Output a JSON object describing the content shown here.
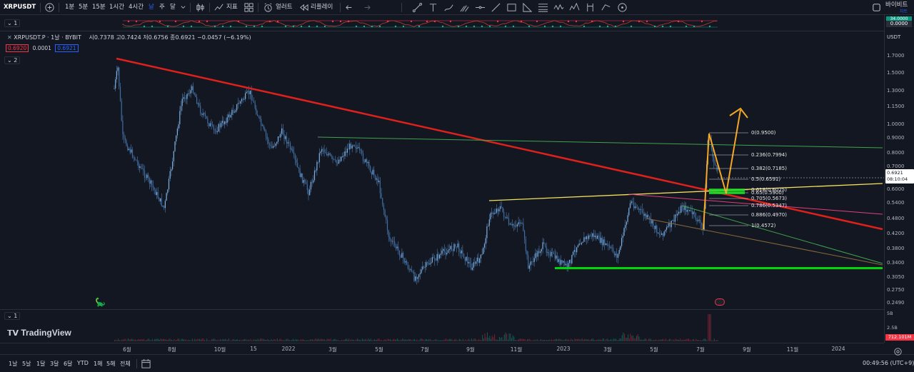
{
  "toolbar": {
    "symbol": "XRPUSDT",
    "intervals": [
      "1분",
      "5분",
      "15분",
      "1시간",
      "4시간",
      "날",
      "주",
      "달"
    ],
    "active_interval": "날",
    "indicators_label": "지표",
    "alert_label": "얼러트",
    "replay_label": "리플레이",
    "exchange_label": "바이비트",
    "exchange_sub": "차트"
  },
  "rsi_pane": {
    "tag": "1",
    "value_label": "34.0000",
    "value_label_2": "0.0000"
  },
  "main_pane": {
    "title": "XRPUSDT.P · 1날 · BYBIT",
    "ohlc": "시0.7378  고0.7424  저0.6756  종0.6921  −0.0457 (−6.19%)",
    "bid": "0.6920",
    "spread": "0.0001",
    "ask": "0.6921",
    "tag": "2",
    "currency": "USDT",
    "last_price": "0.6921",
    "countdown": "08:10:04"
  },
  "price_axis": [
    "1.7000",
    "1.5000",
    "1.3000",
    "1.1500",
    "1.0000",
    "0.9000",
    "0.8000",
    "0.7000",
    "0.6000",
    "0.5400",
    "0.4800",
    "0.4200",
    "0.3800",
    "0.3400",
    "0.3050",
    "0.2750",
    "0.2490"
  ],
  "fib_levels": [
    "0(0.9500)",
    "0.236(0.7994)",
    "0.382(0.7185)",
    "0.5(0.6591)",
    "0.618(0.6025)",
    "0.65(0.5900)",
    "0.705(0.5673)",
    "0.786(0.5347)",
    "0.886(0.4970)",
    "1(0.4572)"
  ],
  "volume_pane": {
    "tag": "1",
    "axis_top": "5B",
    "axis_mid": "2.5B",
    "last_volume": "712.101M"
  },
  "time_axis": [
    "6월",
    "8월",
    "10월",
    "15",
    "2022",
    "3월",
    "5월",
    "7월",
    "9월",
    "11월",
    "2023",
    "3월",
    "5월",
    "7월",
    "9월",
    "11월",
    "2024"
  ],
  "brand": "TradingView",
  "bottombar": {
    "ranges": [
      "1날",
      "5날",
      "1달",
      "3달",
      "6달",
      "YTD",
      "1해",
      "5해",
      "전체"
    ],
    "clock": "00:49:56 (UTC+9)"
  },
  "colors": {
    "background": "#131722",
    "trend_red": "#e0201b",
    "fib_orange": "#f5a623",
    "support_green": "#00d60a",
    "channel_yellow": "#f5e15a",
    "candle": "#5b8fc7"
  }
}
